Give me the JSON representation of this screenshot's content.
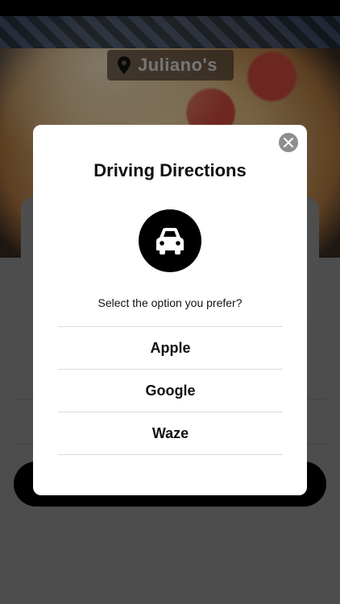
{
  "header": {
    "location_name": "Juliano's"
  },
  "modal": {
    "title": "Driving Directions",
    "prompt": "Select the option you prefer?",
    "options": [
      {
        "label": "Apple"
      },
      {
        "label": "Google"
      },
      {
        "label": "Waze"
      }
    ]
  },
  "icons": {
    "location": "map-pin-icon",
    "close": "close-icon",
    "car": "car-icon"
  },
  "colors": {
    "overlay": "#000000",
    "modal_bg": "#ffffff",
    "close_button": "#8e8e8e",
    "icon_circle": "#000000"
  }
}
